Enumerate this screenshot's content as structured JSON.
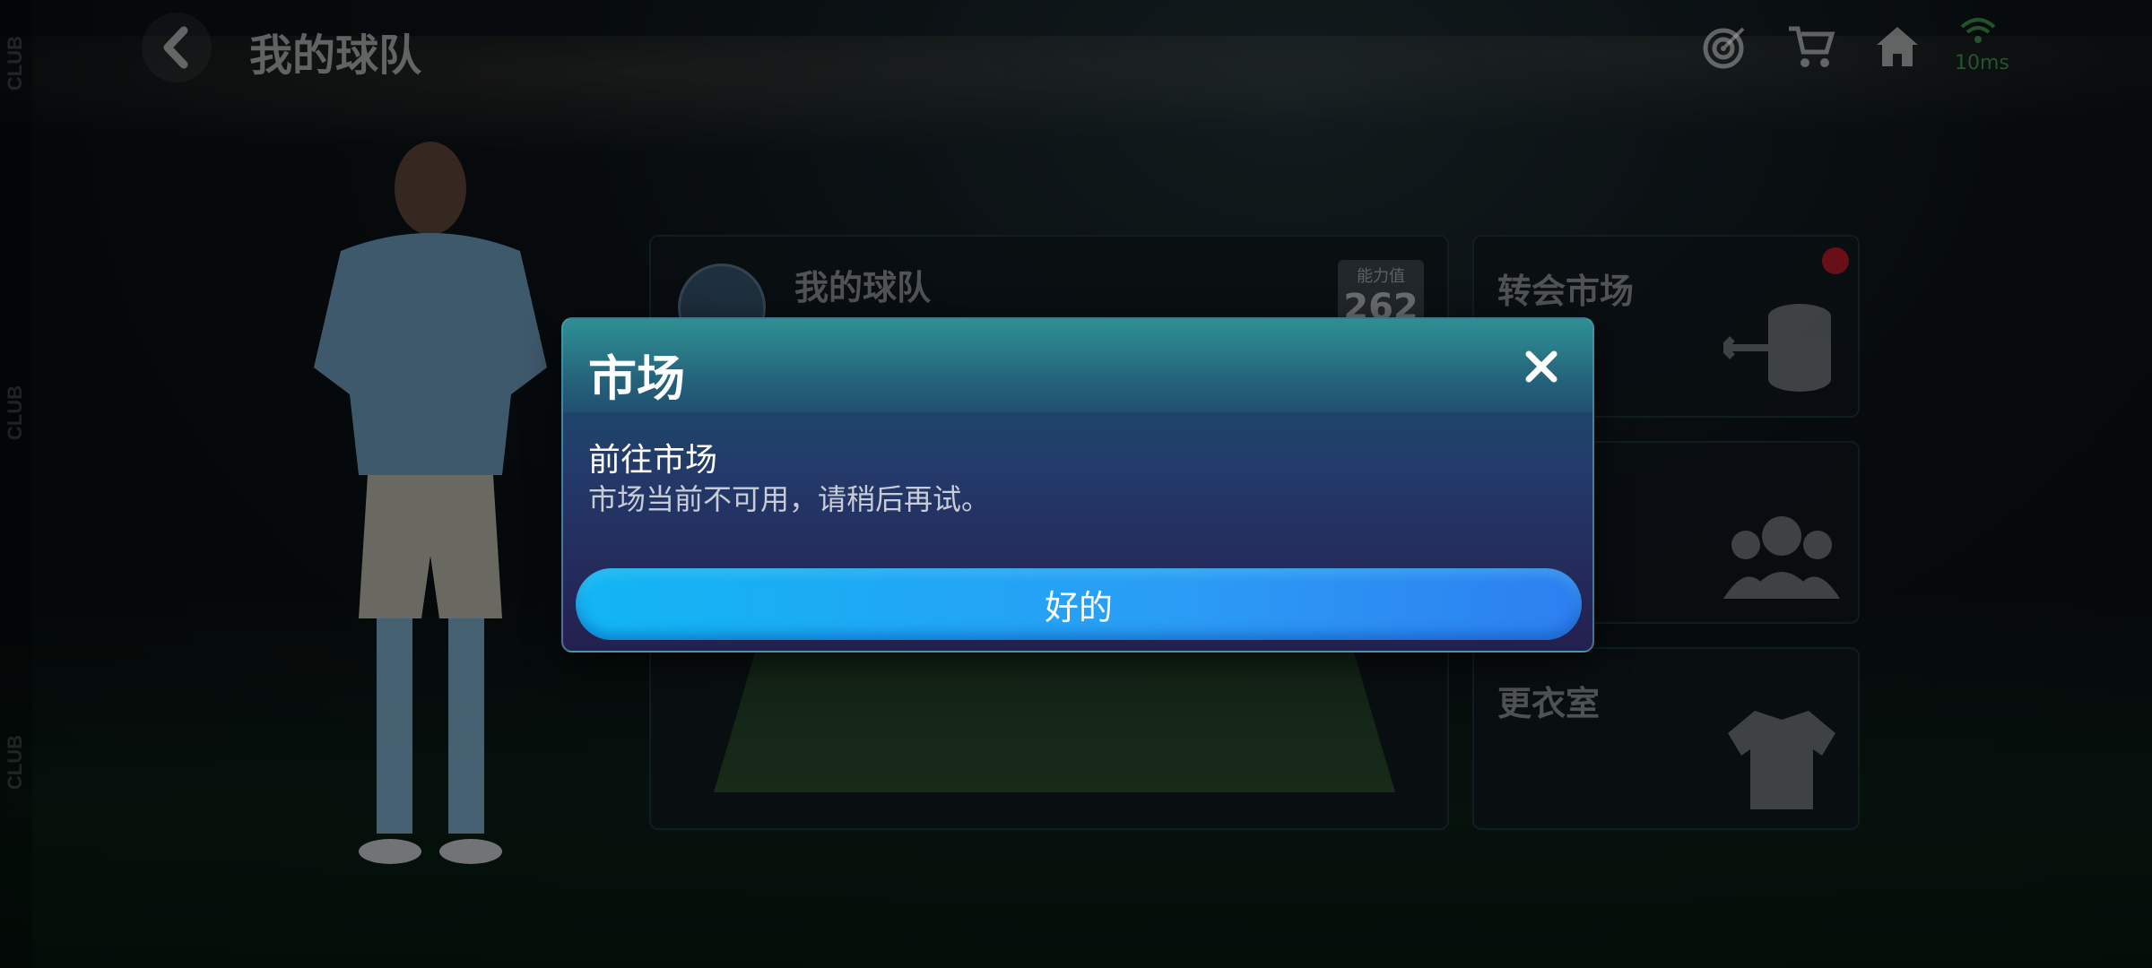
{
  "header": {
    "title": "我的球队",
    "ping": "10ms",
    "icons": [
      "target-icon",
      "cart-icon",
      "home-icon",
      "wifi-icon"
    ]
  },
  "side_strip": {
    "labels": [
      "CLUB",
      "CLUB",
      "CLUB"
    ]
  },
  "cards": {
    "team": {
      "title": "我的球队",
      "rating_label": "能力值",
      "rating_value": "262"
    },
    "transfer": {
      "title": "转会市场",
      "icon": "coins-transfer-icon"
    },
    "middle": {
      "icon": "people-icon"
    },
    "locker": {
      "title": "更衣室",
      "icon": "shirt-icon"
    }
  },
  "dialog": {
    "title": "市场",
    "heading": "前往市场",
    "message": "市场当前不可用，请稍后再试。",
    "ok_label": "好的",
    "close_icon": "close-icon"
  },
  "colors": {
    "accent_button": "#2b9cf5",
    "notification": "#d11a2a",
    "ping_green": "#50c864"
  }
}
